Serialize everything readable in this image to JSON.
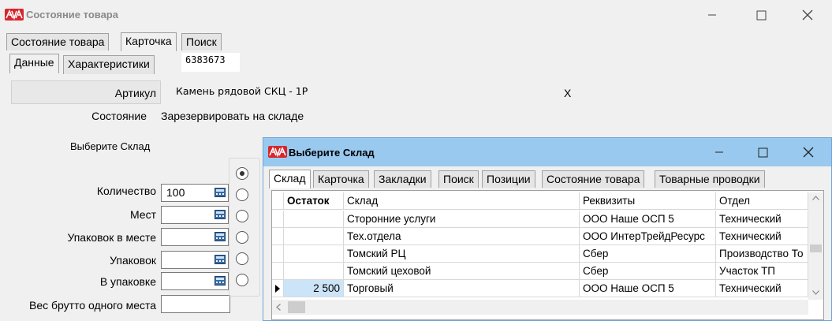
{
  "window": {
    "title": "Состояние товара"
  },
  "top_tabs": [
    "Состояние товара",
    "Карточка",
    "Поиск"
  ],
  "sub_tabs": [
    "Данные",
    "Характеристики"
  ],
  "code": "6383673",
  "fields": {
    "article_label": "Артикул",
    "article_value": "Камень рядовой СКЦ - 1Р",
    "article_x": "X",
    "state_label": "Состояние",
    "state_value": "Зарезервировать на складе",
    "choose_label": "Выберите Склад",
    "qty_label": "Количество",
    "qty_value": "100",
    "places_label": "Мест",
    "packs_per_place_label": "Упаковок в месте",
    "packs_label": "Упаковок",
    "in_pack_label": "В упаковке",
    "gross_label": "Вес брутто одного места"
  },
  "dialog": {
    "title": "Выберите Склад",
    "tabs": [
      "Склад",
      "Карточка",
      "Закладки",
      "Поиск",
      "Позиции",
      "Состояние товара",
      "Товарные проводки"
    ],
    "columns": [
      "Остаток",
      "Склад",
      "Реквизиты",
      "Отдел"
    ],
    "rows": [
      {
        "rest": "",
        "warehouse": "Сторонние услуги",
        "requisites": "ООО Наше ОСП 5",
        "dept": "Технический"
      },
      {
        "rest": "",
        "warehouse": "Тех.отдела",
        "requisites": "ООО ИнтерТрейдРесурс",
        "dept": "Технический"
      },
      {
        "rest": "",
        "warehouse": "Томский РЦ",
        "requisites": "Сбер",
        "dept": "Производство То"
      },
      {
        "rest": "",
        "warehouse": "Томский цеховой",
        "requisites": "Сбер",
        "dept": "Участок ТП"
      },
      {
        "rest": "2 500",
        "warehouse": "Торговый",
        "requisites": "ООО Наше ОСП 5",
        "dept": "Технический"
      }
    ]
  },
  "colors": {
    "dialog_title_bg": "#99c9ef",
    "logo_red": "#d7262d",
    "selected_cell": "#cce4f7"
  }
}
